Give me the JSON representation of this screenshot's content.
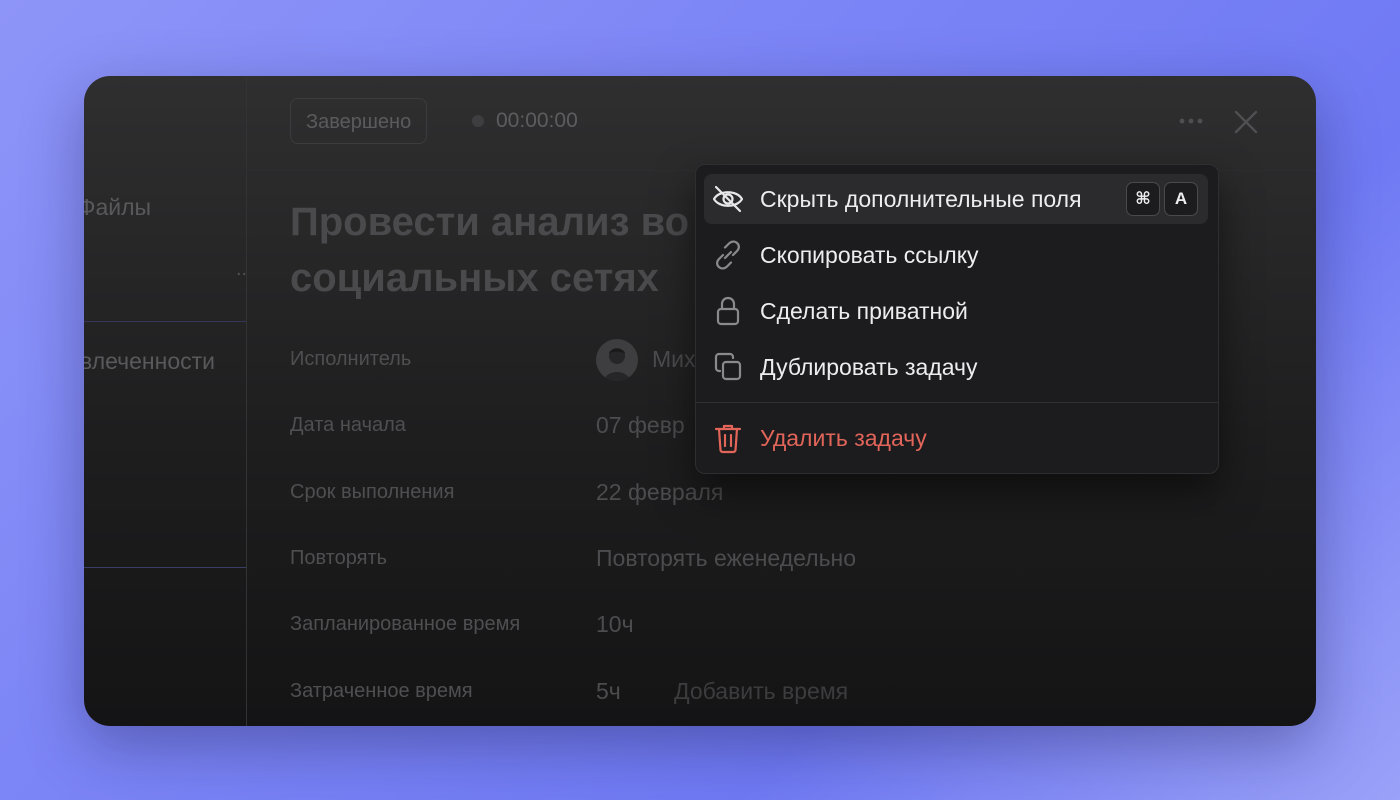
{
  "sidebar": {
    "files_label": "Файлы",
    "dots": "..",
    "engagement_label": "влеченности"
  },
  "header": {
    "status_button": "Завершено",
    "timer": "00:00:00"
  },
  "task": {
    "title": "Провести анализ во\nсоциальных сетях",
    "fields": [
      {
        "label": "Исполнитель",
        "value": "Мих"
      },
      {
        "label": "Дата начала",
        "value": "07 февр"
      },
      {
        "label": "Срок выполнения",
        "value": "22 февраля"
      },
      {
        "label": "Повторять",
        "value": "Повторять еженедельно"
      },
      {
        "label": "Запланированное время",
        "value": "10ч"
      },
      {
        "label": "Затраченное время",
        "value": "5ч"
      }
    ],
    "add_time": "Добавить время"
  },
  "menu": {
    "items": [
      {
        "label": "Скрыть дополнительные поля",
        "icon": "eye-off-icon",
        "shortcut": [
          "⌘",
          "A"
        ]
      },
      {
        "label": "Скопировать ссылку",
        "icon": "link-icon"
      },
      {
        "label": "Сделать приватной",
        "icon": "lock-icon"
      },
      {
        "label": "Дублировать задачу",
        "icon": "duplicate-icon"
      },
      {
        "label": "Удалить задачу",
        "icon": "trash-icon"
      }
    ]
  },
  "colors": {
    "background_from": "#8e95f8",
    "background_to": "#6f79f3",
    "window": "#1e1e1f",
    "menu": "#1c1c1e",
    "danger": "#e2655a"
  }
}
